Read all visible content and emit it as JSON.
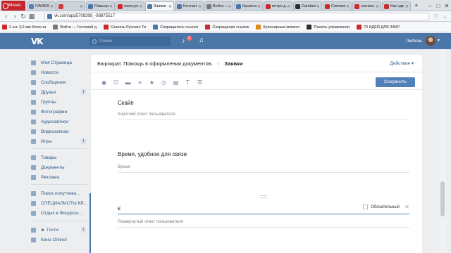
{
  "browser": {
    "menu_label": "Меню",
    "tabs": [
      {
        "label": "IVAREBLC",
        "color": "#5b7fb0",
        "active": false
      },
      {
        "label": "",
        "color": "#d23b3b",
        "active": false
      },
      {
        "label": "Ривьера",
        "color": "#4a76a8",
        "active": false
      },
      {
        "label": "www.you",
        "color": "#cc2a2a",
        "active": false
      },
      {
        "label": "Заявки",
        "color": "#4a76a8",
        "active": true
      },
      {
        "label": "Контакт",
        "color": "#4a76a8",
        "active": false
      },
      {
        "label": "Войти —",
        "color": "#777777",
        "active": false
      },
      {
        "label": "Крымчак",
        "color": "#4a76a8",
        "active": false
      },
      {
        "label": "интро д",
        "color": "#cc2a2a",
        "active": false
      },
      {
        "label": "Camtasia",
        "color": "#2c2c2c",
        "active": false
      },
      {
        "label": "Camtasi",
        "color": "#cc2a2a",
        "active": false
      },
      {
        "label": "скачать",
        "color": "#cc2a2a",
        "active": false
      },
      {
        "label": "Как сде",
        "color": "#cc2a2a",
        "active": false
      }
    ],
    "url": "vk.com/app5708398_-88875517",
    "bookmarks": [
      {
        "label": "2 шт. 3,5 мм Клип на",
        "color": "#cc2a2a"
      },
      {
        "label": "Войти — Гостевой д",
        "color": "#777777"
      },
      {
        "label": "Скачать Русские Ти",
        "color": "#cc2a2a"
      },
      {
        "label": "Сокращатель ссылок",
        "color": "#4a76a8"
      },
      {
        "label": "Сокращение ссылок",
        "color": "#cc2a2a"
      },
      {
        "label": "Кулинарные момент",
        "color": "#e08a1e"
      },
      {
        "label": "Панель управления",
        "color": "#2c2c2c"
      },
      {
        "label": "70 ИДЕЙ ДЛЯ ЗАКР",
        "color": "#cc2a2a"
      }
    ]
  },
  "vk": {
    "logo": "VK",
    "search_placeholder": "Поиск",
    "notif_count": "1",
    "user_name": "Любовь",
    "menu": [
      {
        "label": "Моя Страница",
        "icon": "home-icon",
        "count": ""
      },
      {
        "label": "Новости",
        "icon": "news-icon",
        "count": ""
      },
      {
        "label": "Сообщения",
        "icon": "messages-icon",
        "count": ""
      },
      {
        "label": "Друзья",
        "icon": "friends-icon",
        "count": "1"
      },
      {
        "label": "Группы",
        "icon": "groups-icon",
        "count": ""
      },
      {
        "label": "Фотографии",
        "icon": "photos-icon",
        "count": ""
      },
      {
        "label": "Аудиозаписи",
        "icon": "audio-icon",
        "count": ""
      },
      {
        "label": "Видеозаписи",
        "icon": "video-icon",
        "count": ""
      },
      {
        "label": "Игры",
        "icon": "games-icon",
        "count": "1"
      },
      {
        "label": "Товары",
        "icon": "goods-icon",
        "count": ""
      },
      {
        "label": "Документы",
        "icon": "documents-icon",
        "count": ""
      },
      {
        "label": "Реклама",
        "icon": "ads-icon",
        "count": ""
      },
      {
        "label": "Поиск попутчико...",
        "icon": "travel-icon",
        "count": ""
      },
      {
        "label": "СПЕЦИАЛИСТЫ КР...",
        "icon": "community-icon",
        "count": ""
      },
      {
        "label": "Отдых в Феодоси...",
        "icon": "community-icon",
        "count": ""
      },
      {
        "label": "► Гости",
        "icon": "guests-icon",
        "count": "1"
      },
      {
        "label": "Кино Online!",
        "icon": "cinema-icon",
        "count": ""
      }
    ]
  },
  "app": {
    "breadcrumb_app": "Бюрократ. Помощь в оформлении документов.",
    "breadcrumb_current": "Заявки",
    "actions_label": "Действия",
    "save_label": "Сохранить",
    "toolbar_icons": [
      "radio-icon",
      "checkbox-icon",
      "short-text-icon",
      "long-text-icon",
      "rating-icon",
      "time-icon",
      "calendar-icon",
      "heading-icon",
      "divider-icon"
    ],
    "fields": [
      {
        "title": "Скайп",
        "hint": "Короткий ответ пользователя"
      },
      {
        "title": "Время, удобное для связи",
        "hint": "Время"
      }
    ],
    "editing_field": {
      "question_value": "",
      "required_label": "Обязательный",
      "hint": "Развернутый ответ пользователя"
    }
  }
}
